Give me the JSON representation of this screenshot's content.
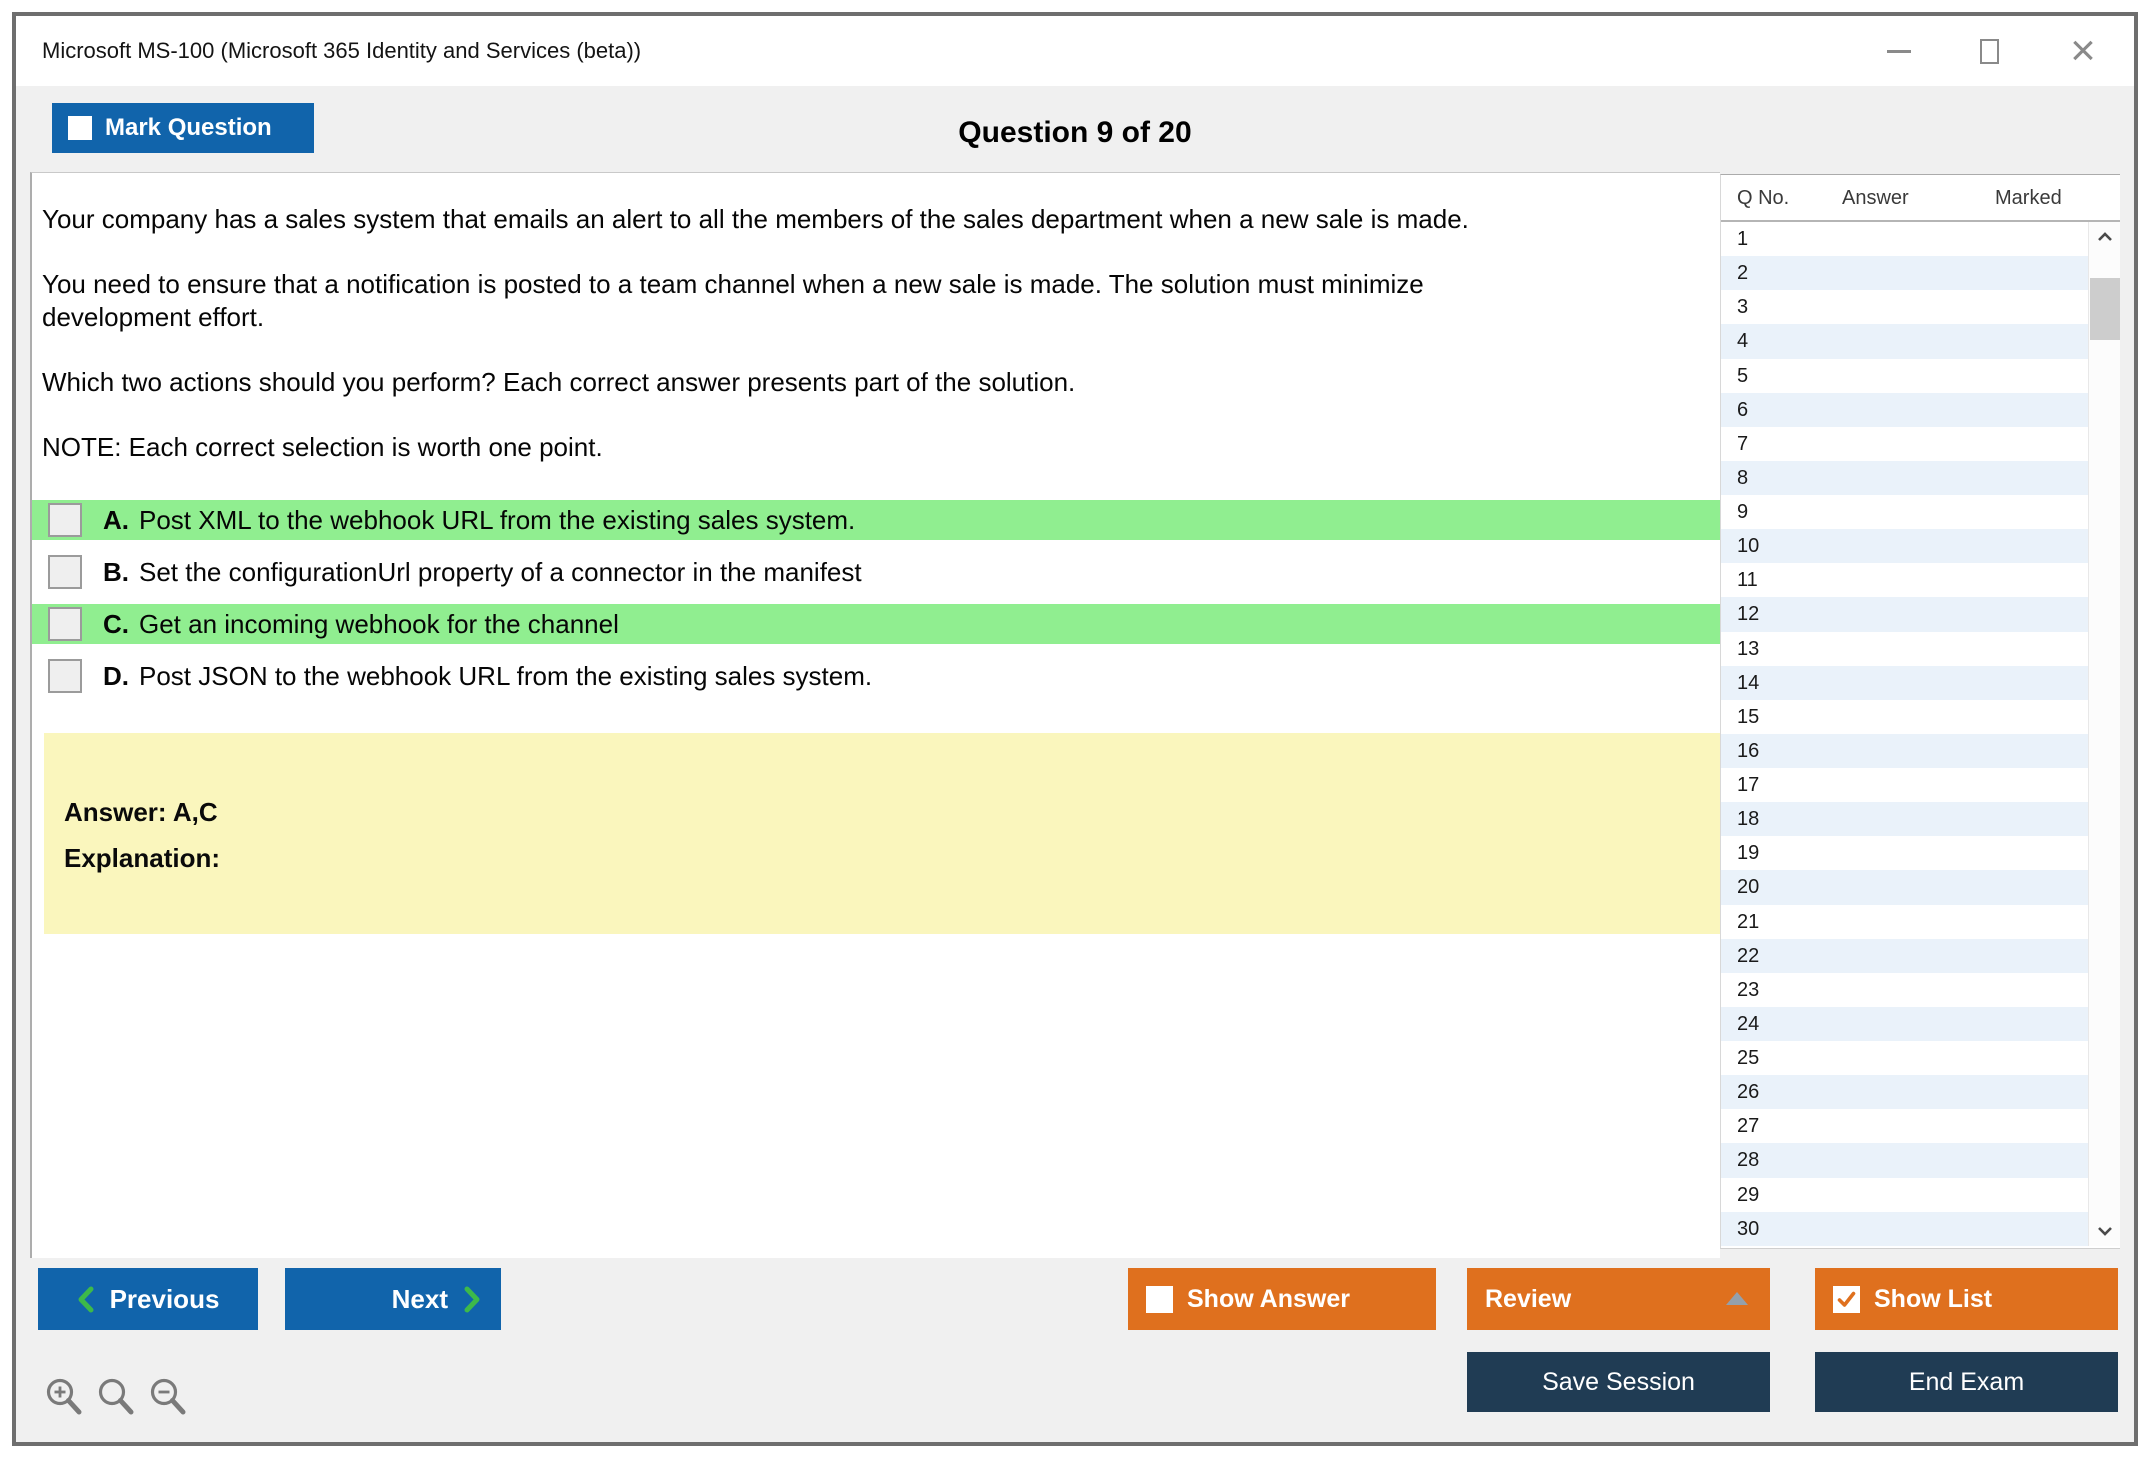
{
  "window": {
    "title": "Microsoft MS-100 (Microsoft 365 Identity and Services (beta))",
    "close_glyph": "×"
  },
  "header": {
    "mark_question_label": "Mark Question",
    "question_counter": "Question 9 of 20"
  },
  "question": {
    "paragraphs": [
      "Your company has a sales system that emails an alert to all the members of the sales department when a new sale is made.",
      "You need to ensure that a notification is posted to a team channel when a new sale is made. The solution must minimize\ndevelopment effort.",
      "Which two actions should you perform? Each correct answer presents part of the solution.",
      "NOTE: Each correct selection is worth one point."
    ],
    "options": [
      {
        "letter": "A.",
        "text": "Post XML to the webhook URL from the existing sales system.",
        "highlighted": true,
        "checked": false
      },
      {
        "letter": "B.",
        "text": "Set the configurationUrl property of a connector in the manifest",
        "highlighted": false,
        "checked": false
      },
      {
        "letter": "C.",
        "text": "Get an incoming webhook for the channel",
        "highlighted": true,
        "checked": false
      },
      {
        "letter": "D.",
        "text": "Post JSON to the webhook URL from the existing sales system.",
        "highlighted": false,
        "checked": false
      }
    ],
    "answer_text": "Answer: A,C",
    "explanation_text": "Explanation:"
  },
  "sidebar": {
    "columns": [
      "Q No.",
      "Answer",
      "Marked"
    ],
    "rows": [
      1,
      2,
      3,
      4,
      5,
      6,
      7,
      8,
      9,
      10,
      11,
      12,
      13,
      14,
      15,
      16,
      17,
      18,
      19,
      20,
      21,
      22,
      23,
      24,
      25,
      26,
      27,
      28,
      29,
      30
    ]
  },
  "footer": {
    "previous_label": "Previous",
    "next_label": "Next",
    "show_answer_label": "Show Answer",
    "show_answer_checked": false,
    "review_label": "Review",
    "show_list_label": "Show List",
    "show_list_checked": true,
    "save_session_label": "Save Session",
    "end_exam_label": "End Exam"
  },
  "colors": {
    "accent_blue": "#1164AB",
    "accent_orange": "#DF701E",
    "navy": "#203C54",
    "highlight_green": "#90EE90",
    "answer_yellow": "#FAF6BD",
    "row_alt_blue": "#EAF2FA",
    "chevron_green": "#3DB94A",
    "window_border": "#6E6E6E"
  }
}
